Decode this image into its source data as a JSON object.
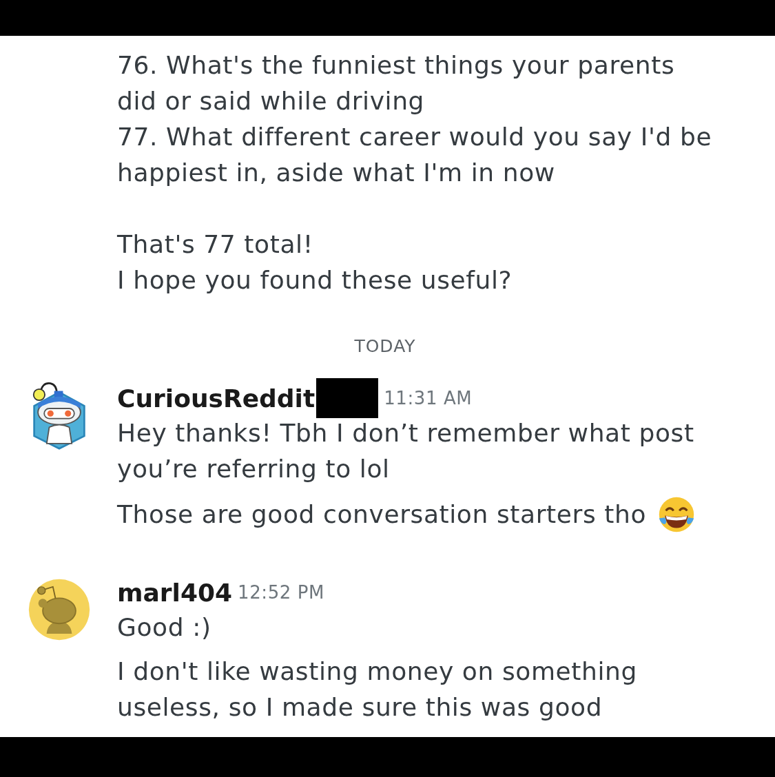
{
  "earlier_message": {
    "blocks": [
      {
        "lines": [
          "76. What's the funniest things your parents did or said while driving",
          "77. What different career would you say I'd be happiest in, aside what I'm in now"
        ]
      },
      {
        "lines": [
          "That's 77 total!",
          "I hope you found these useful?"
        ]
      }
    ]
  },
  "day_divider": "TODAY",
  "messages": [
    {
      "author": "CuriousReddit",
      "redacted": true,
      "time": "11:31 AM",
      "avatar": {
        "kind": "robot"
      },
      "paragraphs": [
        {
          "text": "Hey thanks! Tbh I don’t remember what post you’re referring to lol"
        },
        {
          "text": "Those are good conversation starters tho",
          "emoji": true
        }
      ]
    },
    {
      "author": "marl404",
      "time": "12:52 PM",
      "avatar": {
        "kind": "snoo"
      },
      "paragraphs": [
        {
          "text": "Good :)"
        },
        {
          "text": "I don't like wasting money on something useless, so I made sure this was good"
        }
      ]
    }
  ]
}
